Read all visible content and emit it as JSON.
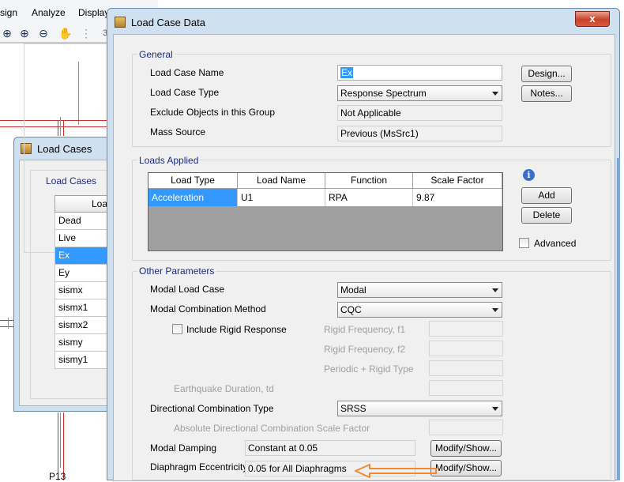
{
  "background_app": {
    "menu": [
      "sign",
      "Analyze",
      "Display"
    ],
    "toolbar_icons": [
      "zoom-window-icon",
      "zoom-in-icon",
      "zoom-out-icon",
      "pan-hand-icon"
    ],
    "toolbar_tail": "3",
    "grid_label": "P13"
  },
  "load_cases_window": {
    "title": "Load Cases",
    "group_label": "Load Cases",
    "column_header": "Loa",
    "items": [
      "Dead",
      "Live",
      "Ex",
      "Ey",
      "sismx",
      "sismx1",
      "sismx2",
      "sismy",
      "sismy1"
    ],
    "selected": "Ex"
  },
  "dialog": {
    "title": "Load Case Data",
    "close_label": "x",
    "general": {
      "label": "General",
      "load_case_name_label": "Load Case Name",
      "load_case_name": "Ex",
      "load_case_type_label": "Load Case Type",
      "load_case_type": "Response Spectrum",
      "exclude_label": "Exclude Objects in this Group",
      "exclude_value": "Not Applicable",
      "mass_source_label": "Mass Source",
      "mass_source_value": "Previous  (MsSrc1)",
      "design_button": "Design...",
      "notes_button": "Notes..."
    },
    "loads_applied": {
      "label": "Loads Applied",
      "columns": [
        "Load Type",
        "Load Name",
        "Function",
        "Scale Factor"
      ],
      "rows": [
        {
          "load_type": "Acceleration",
          "load_name": "U1",
          "function": "RPA",
          "scale_factor": "9.87"
        }
      ],
      "info_glyph": "i",
      "add_button": "Add",
      "delete_button": "Delete",
      "advanced_label": "Advanced"
    },
    "other_parameters": {
      "label": "Other Parameters",
      "modal_load_case_label": "Modal Load Case",
      "modal_load_case": "Modal",
      "modal_combination_label": "Modal Combination Method",
      "modal_combination": "CQC",
      "include_rigid_label": "Include Rigid Response",
      "rigid_f1_label": "Rigid Frequency, f1",
      "rigid_f2_label": "Rigid Frequency, f2",
      "periodic_rigid_label": "Periodic + Rigid Type",
      "earthquake_duration_label": "Earthquake Duration, td",
      "directional_combination_label": "Directional Combination Type",
      "directional_combination": "SRSS",
      "absolute_scale_label": "Absolute Directional Combination Scale Factor",
      "modal_damping_label": "Modal Damping",
      "modal_damping_value": "Constant at 0.05",
      "diaphragm_label": "Diaphragm Eccentricity",
      "diaphragm_value": "0.05 for All Diaphragms",
      "modify_show_button": "Modify/Show..."
    }
  },
  "annotation": {
    "arrow_color": "#f08a30"
  }
}
